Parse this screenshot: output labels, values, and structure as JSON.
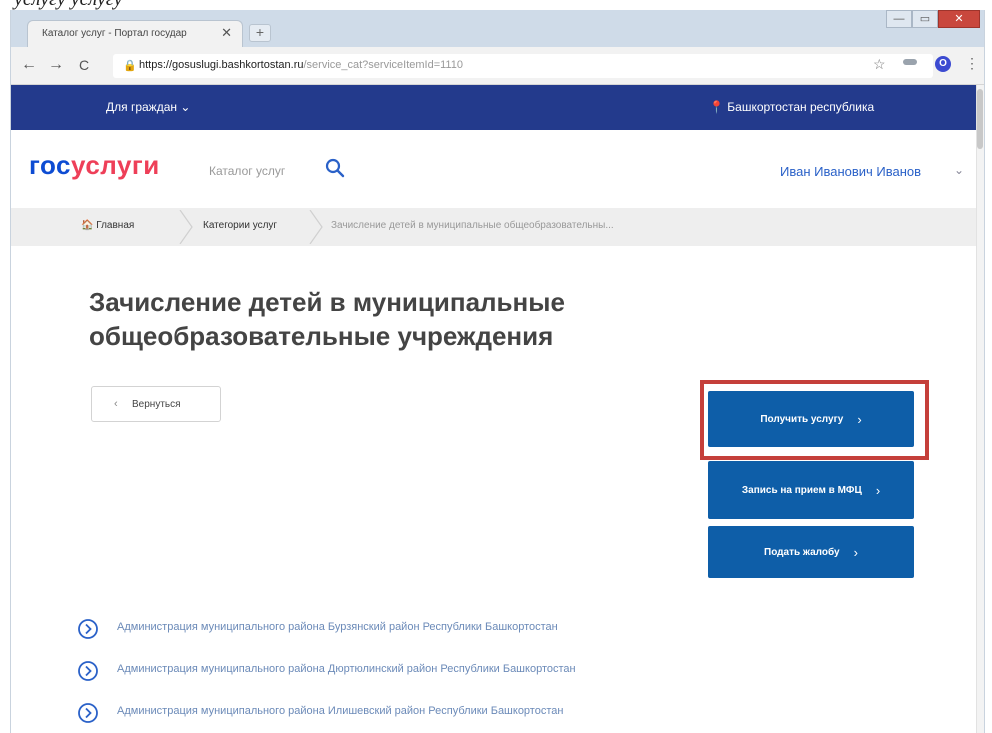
{
  "caption": {
    "text": "услугу услугу"
  },
  "browser": {
    "tab_title": "Каталог услуг - Портал государ",
    "tab_close": "✕",
    "new_tab": "+",
    "win_min": "—",
    "win_max": "▭",
    "win_close": "✕",
    "back": "←",
    "forward": "→",
    "reload": "C",
    "lock": "🔒",
    "url_host": "https://gosuslugi.bashkortostan.ru",
    "url_path": "/service_cat?serviceItemId=1110",
    "star": "☆",
    "profile_initial": "О",
    "menu": "⋮"
  },
  "site": {
    "for_citizens": "Для граждан ⌄",
    "region": "📍 Башкортостан республика",
    "logo_a": "гос",
    "logo_b": "услуги",
    "catalog_label": "Каталог услуг",
    "user_name": "Иван Иванович Иванов",
    "user_chevron": "⌄"
  },
  "breadcrumbs": {
    "home": "🏠 Главная",
    "categories": "Категории услуг",
    "current": "Зачисление детей в муниципальные общеобразовательны..."
  },
  "main": {
    "title": "Зачисление детей в муниципальные общеобразовательные учреждения",
    "back_arrow": "‹",
    "back_label": "Вернуться",
    "actions": [
      {
        "label": "Получить услугу",
        "chev": "›"
      },
      {
        "label": "Запись на прием в МФЦ",
        "chev": "›"
      },
      {
        "label": "Подать жалобу",
        "chev": "›"
      }
    ],
    "list": [
      "Администрация муниципального района Бурзянский район Республики Башкортостан",
      "Администрация муниципального района Дюртюлинский район Республики Башкортостан",
      "Администрация муниципального района Илишевский район Республики Башкортостан"
    ]
  },
  "colors": {
    "brand_blue": "#233a8c",
    "action_blue": "#0e5ea8",
    "logo_red": "#ee3f58",
    "highlight_red": "#c53f3a"
  }
}
